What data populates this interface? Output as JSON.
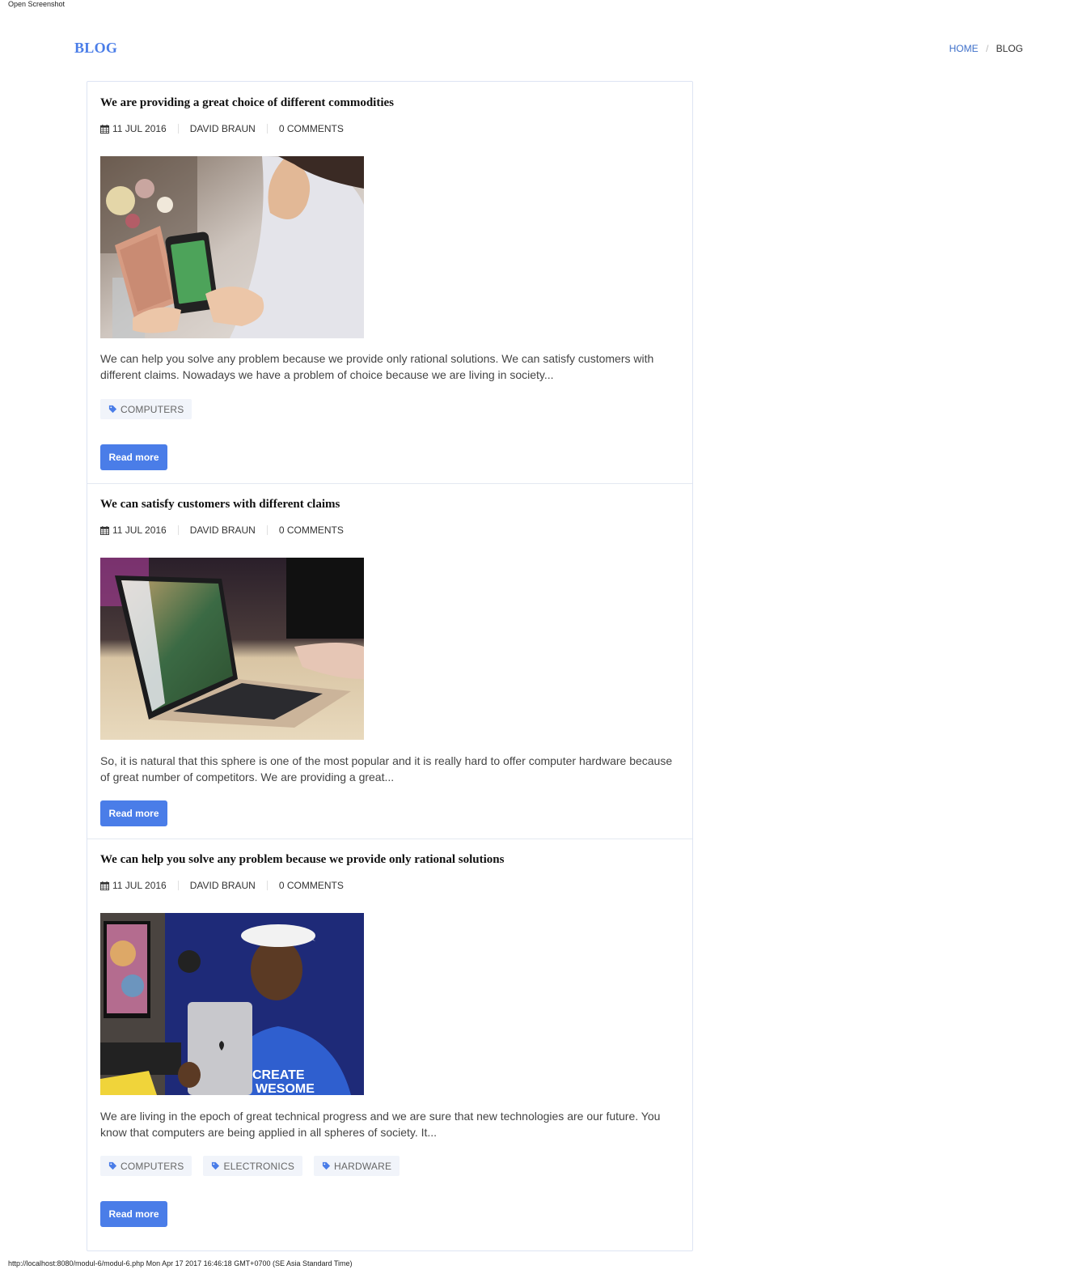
{
  "window": {
    "caption": "Open Screenshot"
  },
  "header": {
    "title": "BLOG",
    "breadcrumb": {
      "home": "HOME",
      "separator": "/",
      "current": "BLOG"
    }
  },
  "posts": [
    {
      "title": "We are providing a great choice of different commodities",
      "date": "11 JUL 2016",
      "author": "DAVID BRAUN",
      "comments": "0 COMMENTS",
      "excerpt": "We can help you solve any problem because we provide only rational solutions. We can satisfy customers with different claims. Nowadays we have a problem of choice because we are living in society...",
      "tags": [
        "COMPUTERS"
      ],
      "read_more": "Read more"
    },
    {
      "title": "We can satisfy customers with different claims",
      "date": "11 JUL 2016",
      "author": "DAVID BRAUN",
      "comments": "0 COMMENTS",
      "excerpt": "So, it is natural that this sphere is one of the most popular and it is really hard to offer computer hardware because of great number of competitors. We are providing a great...",
      "tags": [],
      "read_more": "Read more"
    },
    {
      "title": "We can help you solve any problem because we provide only rational solutions",
      "date": "11 JUL 2016",
      "author": "DAVID BRAUN",
      "comments": "0 COMMENTS",
      "excerpt": "We are living in the epoch of great technical progress and we are sure that new technologies are our future. You know that computers are being applied in all spheres of society. It...",
      "tags": [
        "COMPUTERS",
        "ELECTRONICS",
        "HARDWARE"
      ],
      "read_more": "Read more"
    }
  ],
  "footer": {
    "caption": "http://localhost:8080/modul-6/modul-6.php Mon Apr 17 2017 16:46:18 GMT+0700 (SE Asia Standard Time)"
  },
  "colors": {
    "accent": "#4a7de8",
    "link": "#3d6fc9",
    "tag_bg": "#f1f4fa"
  }
}
